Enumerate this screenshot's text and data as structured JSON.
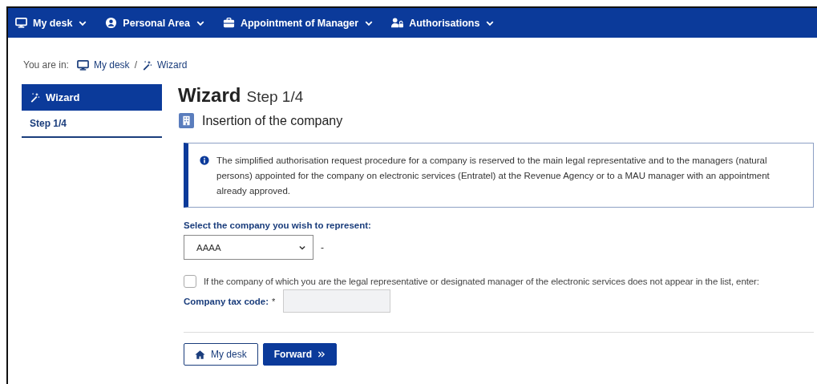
{
  "nav": [
    {
      "label": "My desk"
    },
    {
      "label": "Personal Area"
    },
    {
      "label": "Appointment of Manager"
    },
    {
      "label": "Authorisations"
    }
  ],
  "breadcrumb": {
    "prefix": "You are in:",
    "items": [
      "My desk",
      "Wizard"
    ],
    "separator": "/"
  },
  "sidebar": {
    "title": "Wizard",
    "items": [
      {
        "label": "Step 1/4",
        "selected": true
      }
    ]
  },
  "page": {
    "title": "Wizard",
    "subtitle": "Step 1/4"
  },
  "section": {
    "title": "Insertion of the company"
  },
  "info": "The simplified authorisation request procedure for a company is reserved to the main legal representative and to the managers (natural persons) appointed for the company on electronic services (Entratel) at the Revenue Agency or to a MAU manager with an appointment already approved.",
  "company_select": {
    "label": "Select the company you wish to represent:",
    "value": "AAAA",
    "suffix": "-"
  },
  "manual_entry": {
    "checked": false,
    "label": "If the company of which you are the legal representative or designated manager of the electronic services does not appear in the list, enter:"
  },
  "tax_code": {
    "label": "Company tax code:",
    "required_mark": "*"
  },
  "buttons": [
    {
      "label": "My desk",
      "kind": "secondary"
    },
    {
      "label": "Forward",
      "kind": "primary"
    }
  ]
}
